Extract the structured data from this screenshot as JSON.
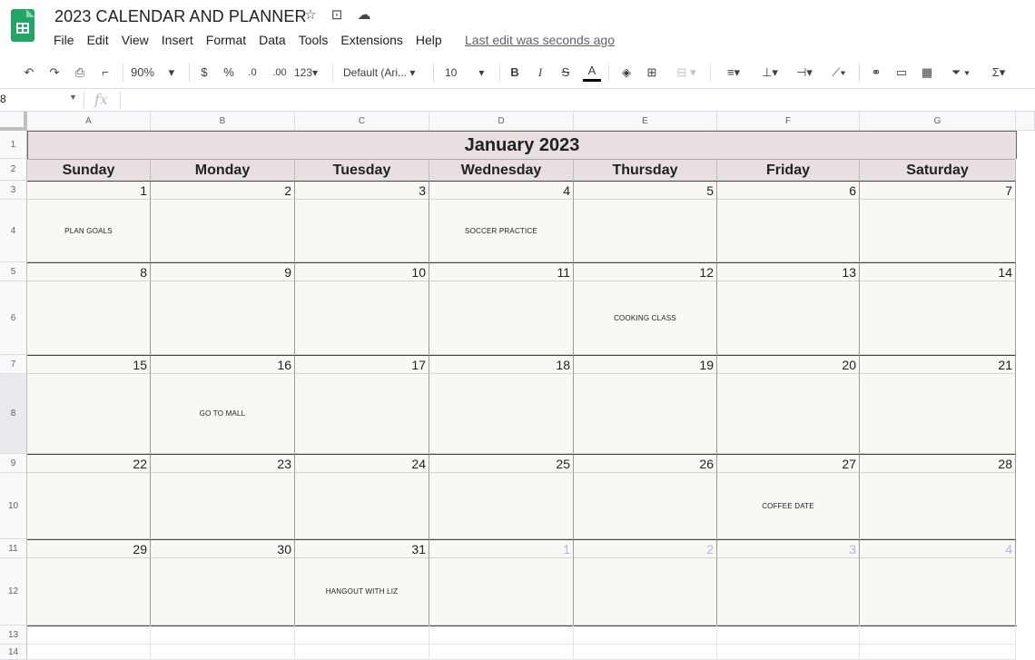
{
  "doc": {
    "title": "2023 CALENDAR AND PLANNER",
    "last_edit": "Last edit was seconds ago"
  },
  "menu": [
    "File",
    "Edit",
    "View",
    "Insert",
    "Format",
    "Data",
    "Tools",
    "Extensions",
    "Help"
  ],
  "toolbar": {
    "zoom": "90%",
    "currency": "$",
    "percent": "%",
    "dec_less": ".0",
    "dec_more": ".00",
    "format_more": "123",
    "font": "Default (Ari...",
    "font_size": "10"
  },
  "formula": {
    "name_box": "8",
    "fx": "fx",
    "value": ""
  },
  "columns": [
    "A",
    "B",
    "C",
    "D",
    "E",
    "F",
    "G"
  ],
  "rows": [
    "1",
    "2",
    "3",
    "4",
    "5",
    "6",
    "7",
    "8",
    "9",
    "10",
    "11",
    "12",
    "13",
    "14"
  ],
  "calendar": {
    "month": "January 2023",
    "days": [
      "Sunday",
      "Monday",
      "Tuesday",
      "Wednesday",
      "Thursday",
      "Friday",
      "Saturday"
    ],
    "weeks": [
      {
        "nums": [
          "1",
          "2",
          "3",
          "4",
          "5",
          "6",
          "7"
        ],
        "events": [
          "PLAN GOALS",
          "",
          "",
          "SOCCER PRACTICE",
          "",
          "",
          ""
        ],
        "faded": [
          false,
          false,
          false,
          false,
          false,
          false,
          false
        ]
      },
      {
        "nums": [
          "8",
          "9",
          "10",
          "11",
          "12",
          "13",
          "14"
        ],
        "events": [
          "",
          "",
          "",
          "",
          "COOKING CLASS",
          "",
          ""
        ],
        "faded": [
          false,
          false,
          false,
          false,
          false,
          false,
          false
        ]
      },
      {
        "nums": [
          "15",
          "16",
          "17",
          "18",
          "19",
          "20",
          "21"
        ],
        "events": [
          "",
          "GO TO MALL",
          "",
          "",
          "",
          "",
          ""
        ],
        "faded": [
          false,
          false,
          false,
          false,
          false,
          false,
          false
        ]
      },
      {
        "nums": [
          "22",
          "23",
          "24",
          "25",
          "26",
          "27",
          "28"
        ],
        "events": [
          "",
          "",
          "",
          "",
          "",
          "COFFEE DATE",
          ""
        ],
        "faded": [
          false,
          false,
          false,
          false,
          false,
          false,
          false
        ]
      },
      {
        "nums": [
          "29",
          "30",
          "31",
          "1",
          "2",
          "3",
          "4"
        ],
        "events": [
          "",
          "",
          "HANGOUT WITH LIZ",
          "",
          "",
          "",
          ""
        ],
        "faded": [
          false,
          false,
          false,
          true,
          true,
          true,
          true
        ]
      }
    ]
  }
}
